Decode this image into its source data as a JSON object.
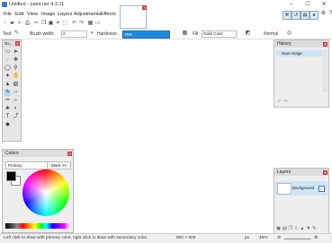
{
  "window": {
    "title": "Untitled - paint.net 4.3.11",
    "minimize": "–",
    "maximize": "☐",
    "close": "✕"
  },
  "menu": [
    "File",
    "Edit",
    "View",
    "Image",
    "Layers",
    "Adjustments",
    "Effects"
  ],
  "toolbar": {
    "tool_label": "Tool:",
    "brush_width_label": "Brush width:",
    "brush_width_value": "2",
    "hardness_label": "Hardness:",
    "hardness_value": "75%",
    "fill_label": "Fill:",
    "fill_value": "Solid Color",
    "blend_mode": "Normal"
  },
  "tools_panel": {
    "title": "To...",
    "close": "✕"
  },
  "history": {
    "title": "History",
    "close": "✕",
    "items": [
      "New Image"
    ]
  },
  "layers": {
    "title": "Layers",
    "close": "✕",
    "items": [
      {
        "name": "Background",
        "visible": "✓"
      }
    ]
  },
  "colors": {
    "title": "Colors",
    "close": "✕",
    "mode": "Primary",
    "more_button": "More >>",
    "primary_color": "#000000",
    "secondary_color": "#ffffff"
  },
  "status": {
    "hint": "Left click to draw with primary color, right click to draw with secondary color.",
    "size": "800 × 600",
    "units": "px",
    "zoom": "46%"
  }
}
